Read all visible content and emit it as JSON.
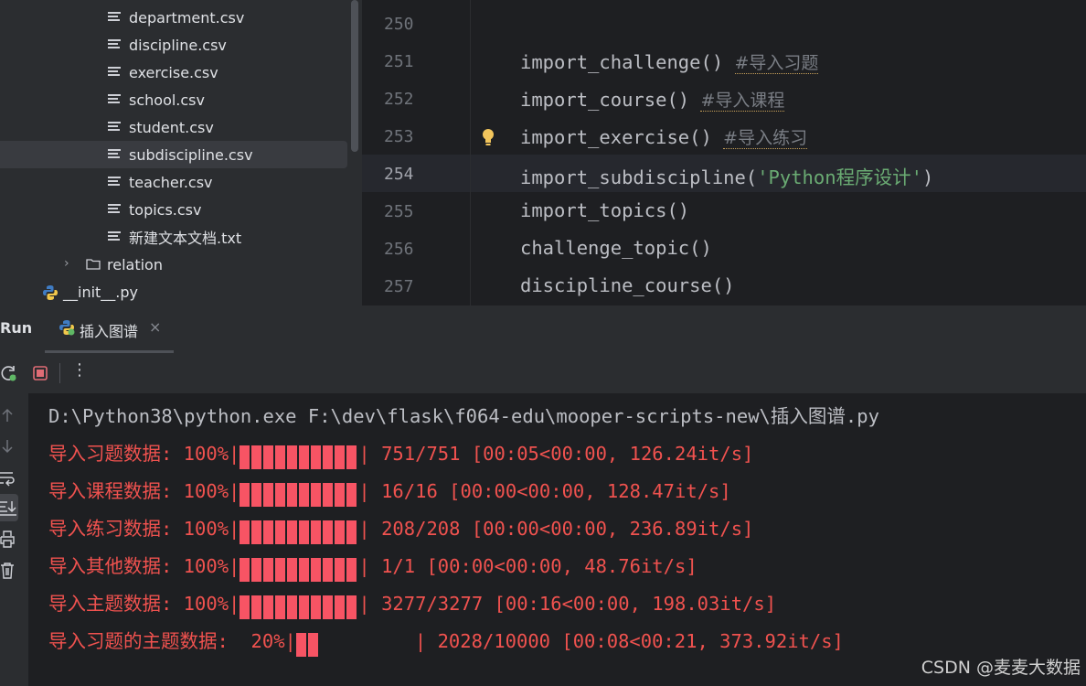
{
  "project_tree": {
    "files": [
      {
        "name": "department.csv"
      },
      {
        "name": "discipline.csv"
      },
      {
        "name": "exercise.csv"
      },
      {
        "name": "school.csv"
      },
      {
        "name": "student.csv"
      },
      {
        "name": "subdiscipline.csv",
        "selected": true
      },
      {
        "name": "teacher.csv"
      },
      {
        "name": "topics.csv"
      },
      {
        "name": "新建文本文档.txt"
      }
    ],
    "folder": "relation",
    "python_file": "__init__.py"
  },
  "editor": {
    "lines": [
      {
        "num": "250",
        "code": ""
      },
      {
        "num": "251",
        "code": "import_challenge()",
        "comment": "#导入习题"
      },
      {
        "num": "252",
        "code": "import_course()",
        "comment": "#导入课程"
      },
      {
        "num": "253",
        "code": "import_exercise()",
        "comment": "#导入练习"
      },
      {
        "num": "254",
        "code_before": "import_subdiscipline(",
        "string": "'Python程序设计'",
        "code_after": ")"
      },
      {
        "num": "255",
        "code": "import_topics()"
      },
      {
        "num": "256",
        "code": "challenge_topic()"
      },
      {
        "num": "257",
        "code": "discipline_course()"
      }
    ],
    "current_line": "254"
  },
  "run": {
    "title": "Run",
    "tab_label": "插入图谱",
    "tab_close": "×",
    "more": "⋮"
  },
  "console": {
    "command": "D:\\Python38\\python.exe F:\\dev\\flask\\f064-edu\\mooper-scripts-new\\插入图谱.py",
    "progress": [
      {
        "label": "导入习题数据: 100%|",
        "fraction": 1.0,
        "stats": "| 751/751 [00:05<00:00, 126.24it/s]"
      },
      {
        "label": "导入课程数据: 100%|",
        "fraction": 1.0,
        "stats": "| 16/16 [00:00<00:00, 128.47it/s]"
      },
      {
        "label": "导入练习数据: 100%|",
        "fraction": 1.0,
        "stats": "| 208/208 [00:00<00:00, 236.89it/s]"
      },
      {
        "label": "导入其他数据: 100%|",
        "fraction": 1.0,
        "stats": "| 1/1 [00:00<00:00, 48.76it/s]"
      },
      {
        "label": "导入主题数据: 100%|",
        "fraction": 1.0,
        "stats": "| 3277/3277 [00:16<00:00, 198.03it/s]"
      },
      {
        "label": "导入习题的主题数据:  20%|",
        "fraction": 0.2,
        "stats": "| 2028/10000 [00:08<00:21, 373.92it/s]"
      }
    ]
  },
  "watermark": "CSDN @麦麦大数据",
  "colors": {
    "error_text": "#f0524f",
    "progress_bar": "#f75464",
    "string": "#6aab73",
    "comment": "#7a7e85"
  }
}
